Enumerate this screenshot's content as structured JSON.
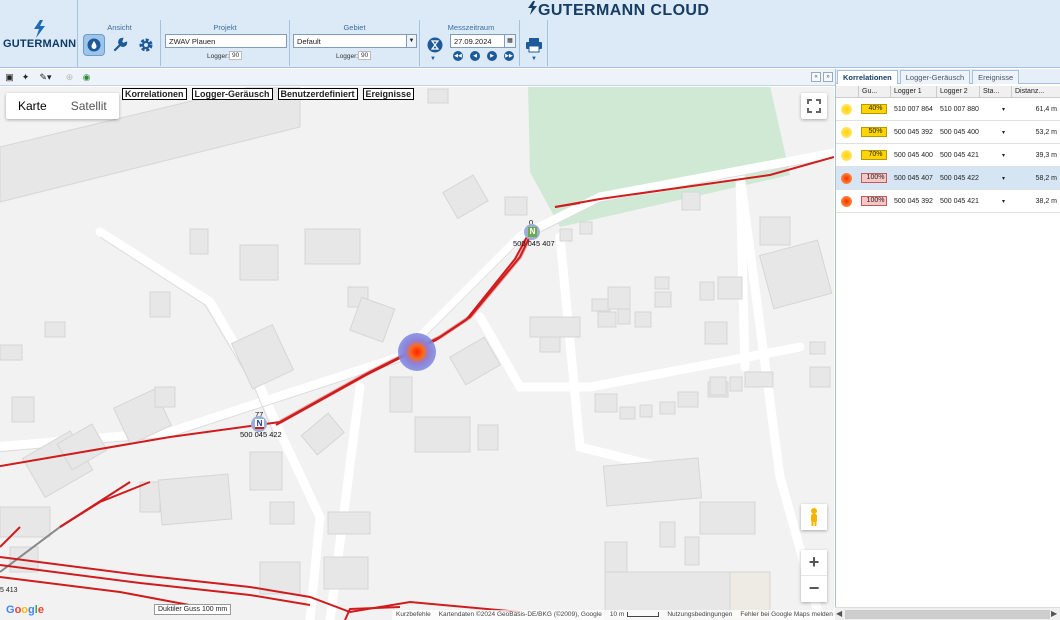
{
  "app": {
    "brand": "GUTERMANN",
    "cloud_title": "GUTERMANN CLOUD"
  },
  "toolbar": {
    "ansicht_label": "Ansicht",
    "projekt_label": "Projekt",
    "projekt_value": "ZWAV Plauen",
    "projekt_logger_label": "Logger:",
    "projekt_logger_count": "90",
    "gebiet_label": "Gebiet",
    "gebiet_value": "Default",
    "gebiet_logger_label": "Logger:",
    "gebiet_logger_count": "90",
    "messzeitraum_label": "Messzeitraum",
    "messzeitraum_value": "27.09.2024"
  },
  "map": {
    "maptype": {
      "map": "Karte",
      "satellite": "Satellit"
    },
    "filters": [
      "Korrelationen",
      "Logger-Geräusch",
      "Benutzerdefiniert",
      "Ereignisse"
    ],
    "loggers": [
      {
        "id": "500 045 407",
        "count": "0",
        "type": "N"
      },
      {
        "id": "500 045 422",
        "count": "77",
        "type": "N"
      }
    ],
    "edge_label": "5 413",
    "pipe_tooltip": "Duktiler Guss 100 mm",
    "attribution": {
      "shortcuts": "Kurzbefehle",
      "data": "Kartendaten ©2024 GeoBasis-DE/BKG (©2009), Google",
      "scale": "10 m",
      "terms": "Nutzungsbedingungen",
      "report": "Fehler bei Google Maps melden"
    },
    "google_letters": [
      "G",
      "o",
      "o",
      "g",
      "l",
      "e"
    ]
  },
  "panel": {
    "tabs": [
      "Korrelationen",
      "Logger-Geräusch",
      "Ereignisse"
    ],
    "columns": [
      "Gu...",
      "Logger 1",
      "Logger 2",
      "Sta...",
      "Distanz..."
    ],
    "rows": [
      {
        "quality": "40%",
        "logger1": "510 007 864",
        "logger2": "510 007 880",
        "status": "▾",
        "distance": "61,4 m",
        "level": "yellow"
      },
      {
        "quality": "50%",
        "logger1": "500 045 392",
        "logger2": "500 045 400",
        "status": "▾",
        "distance": "53,2 m",
        "level": "yellow"
      },
      {
        "quality": "70%",
        "logger1": "500 045 400",
        "logger2": "500 045 421",
        "status": "▾",
        "distance": "39,3 m",
        "level": "yellow"
      },
      {
        "quality": "100%",
        "logger1": "500 045 407",
        "logger2": "500 045 422",
        "status": "▾",
        "distance": "58,2 m",
        "level": "red"
      },
      {
        "quality": "100%",
        "logger1": "500 045 392",
        "logger2": "500 045 421",
        "status": "▾",
        "distance": "38,2 m",
        "level": "red"
      }
    ]
  },
  "colors": {
    "pipe": "#d01c1c",
    "park": "#cfe9d5",
    "accent": "#1c5a99"
  }
}
